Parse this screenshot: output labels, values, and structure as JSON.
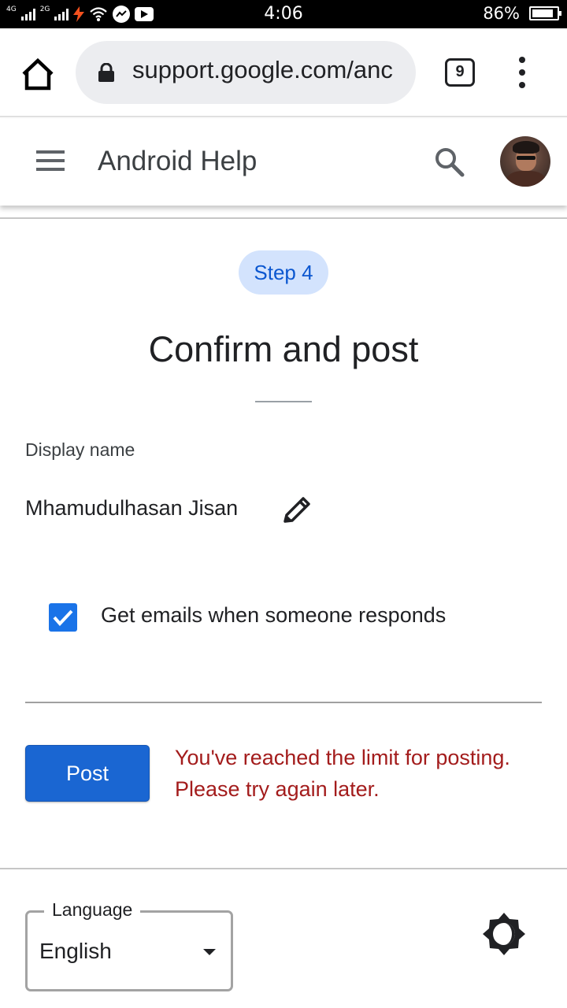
{
  "status_bar": {
    "network_left": "4G",
    "network_right": "2G",
    "time": "4:06",
    "battery_percent": "86%",
    "battery_level": 0.86,
    "icons": [
      "signal-icon",
      "signal-icon",
      "bolt-icon",
      "wifi-icon",
      "messenger-icon",
      "youtube-icon",
      "battery-icon"
    ]
  },
  "browser": {
    "home_icon": "home-icon",
    "lock_icon": "lock-icon",
    "url": "support.google.com/anc",
    "tab_count": "9",
    "menu_icon": "more-vert-icon"
  },
  "header": {
    "menu_icon": "hamburger-icon",
    "title": "Android Help",
    "search_icon": "search-icon",
    "avatar": "avatar"
  },
  "form": {
    "step_label": "Step 4",
    "title": "Confirm and post",
    "display_name_label": "Display name",
    "display_name": "Mhamudulhasan Jisan",
    "edit_icon": "pencil-icon",
    "email_checkbox_checked": true,
    "email_checkbox_label": "Get emails when someone responds",
    "post_label": "Post",
    "error_line_1": "You've reached the limit for posting.",
    "error_line_2": "Please try again later."
  },
  "footer": {
    "language_label": "Language",
    "language_value": "English",
    "theme_icon": "theme-toggle-icon"
  },
  "colors": {
    "accent": "#1a73e8",
    "step_badge_bg": "#d3e3fd",
    "error": "#a31c1c",
    "status_bar_bg": "#000000"
  }
}
